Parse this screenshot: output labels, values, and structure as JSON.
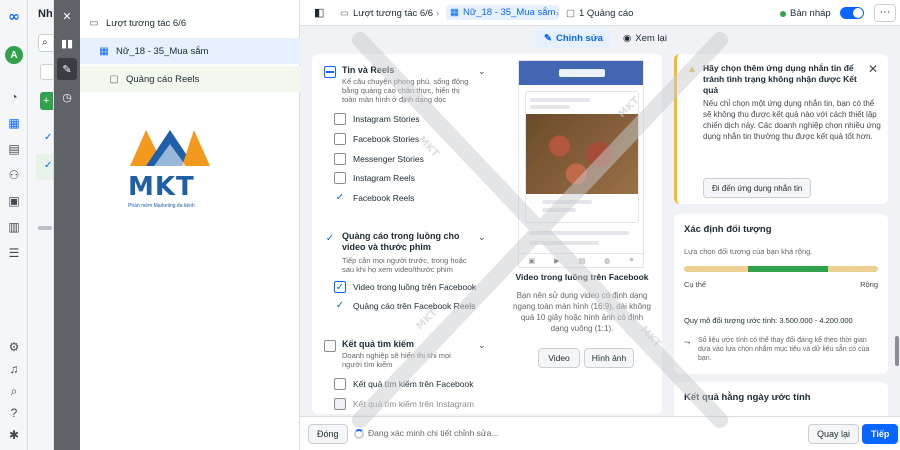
{
  "global_rail": {
    "icons": [
      "meta-icon",
      "avatar",
      "dashboard-icon",
      "table-icon",
      "pages-icon",
      "audience-icon",
      "layers-icon",
      "billing-icon",
      "menu-icon",
      "settings-icon",
      "notifications-icon",
      "search-icon",
      "help-icon",
      "bug-icon"
    ],
    "avatar_letter": "A"
  },
  "campaign_column": {
    "title_cut": "Nhó"
  },
  "tree": {
    "campaign": "Lượt tương tác 6/6",
    "adset": "Nữ_18 - 35_Mua sắm",
    "ad": "Quảng cáo Reels"
  },
  "logo": {
    "text": "MKT",
    "tagline": "Phần mềm Marketing đa kênh",
    "colors": {
      "orange": "#f39a1e",
      "blue": "#1e5fa8"
    }
  },
  "topbar": {
    "crumb_campaign": "Lượt tương tác 6/6",
    "crumb_adset": "Nữ_18 - 35_Mua sắm",
    "crumb_ad": "1 Quảng cáo",
    "status": "Bản nháp",
    "more": "···"
  },
  "tabs": {
    "edit": "Chỉnh sửa",
    "review": "Xem lại"
  },
  "placements": {
    "stories": {
      "title": "Tin và Reels",
      "desc": "Kể câu chuyện phong phú, sống động bằng quảng cáo chân thực, hiển thị toàn màn hình ở định dạng dọc",
      "options": [
        {
          "label": "Instagram Stories",
          "checked": false
        },
        {
          "label": "Facebook Stories",
          "checked": false
        },
        {
          "label": "Messenger Stories",
          "checked": false
        },
        {
          "label": "Instagram Reels",
          "checked": false
        },
        {
          "label": "Facebook Reels",
          "checked": true
        }
      ]
    },
    "instream": {
      "title": "Quảng cáo trong luồng cho video và thước phim",
      "desc": "Tiếp cận mọi người trước, trong hoặc sau khi họ xem video/thước phim",
      "options": [
        {
          "label": "Video trong luồng trên Facebook",
          "checked": true
        },
        {
          "label": "Quảng cáo trên Facebook Reels",
          "checked": true
        }
      ]
    },
    "search": {
      "title": "Kết quả tìm kiếm",
      "desc": "Doanh nghiệp sẽ hiển thị khi mọi người tìm kiếm",
      "options": [
        {
          "label": "Kết quả tìm kiếm trên Facebook",
          "checked": false
        },
        {
          "label": "Kết quả tìm kiếm trên Instagram",
          "checked": false
        }
      ]
    }
  },
  "preview": {
    "caption": "Video trong luồng trên Facebook",
    "note": "Bạn nên sử dụng video có định dạng ngang toàn màn hình (16:9), dài không quá 10 giây hoặc hình ảnh có định dạng vuông (1:1).",
    "btn_video": "Video",
    "btn_image": "Hình ảnh"
  },
  "alert": {
    "title": "Hãy chọn thêm ứng dụng nhắn tin để tránh tình trạng không nhận được Kết quả",
    "body": "Nếu chỉ chọn một ứng dụng nhắn tin, bạn có thể sẽ không thu được kết quả nào với cách thiết lập chiến dịch này. Các doanh nghiệp chọn nhiều ứng dụng nhắn tin thường thu được kết quả tốt hơn.",
    "button": "Đi đến ứng dụng nhắn tin",
    "accent": "#f7b928"
  },
  "audience": {
    "title": "Xác định đối tượng",
    "subtitle": "Lựa chọn đối tượng của bạn khá rộng.",
    "label_specific": "Cụ thể",
    "label_broad": "Rộng",
    "size_text": "Quy mô đối tượng ước tính: 3.500.000 - 4.200.000",
    "note": "Số liệu ước tính có thể thay đổi đáng kể theo thời gian dựa vào lựa chọn nhắm mục tiêu và dữ liệu sẵn có của bạn.",
    "level": 0.62,
    "colors": {
      "low": "#f7b928",
      "mid": "#31a24c",
      "high": "#f7b928"
    }
  },
  "results": {
    "title": "Kết quả hằng ngày ước tính"
  },
  "bottombar": {
    "close": "Đóng",
    "status": "Đang xác minh chi tiết chỉnh sửa...",
    "back": "Quay lại",
    "next": "Tiếp"
  },
  "colors": {
    "primary": "#0866ff",
    "success": "#31a24c",
    "toolbar": "#5f6368"
  }
}
